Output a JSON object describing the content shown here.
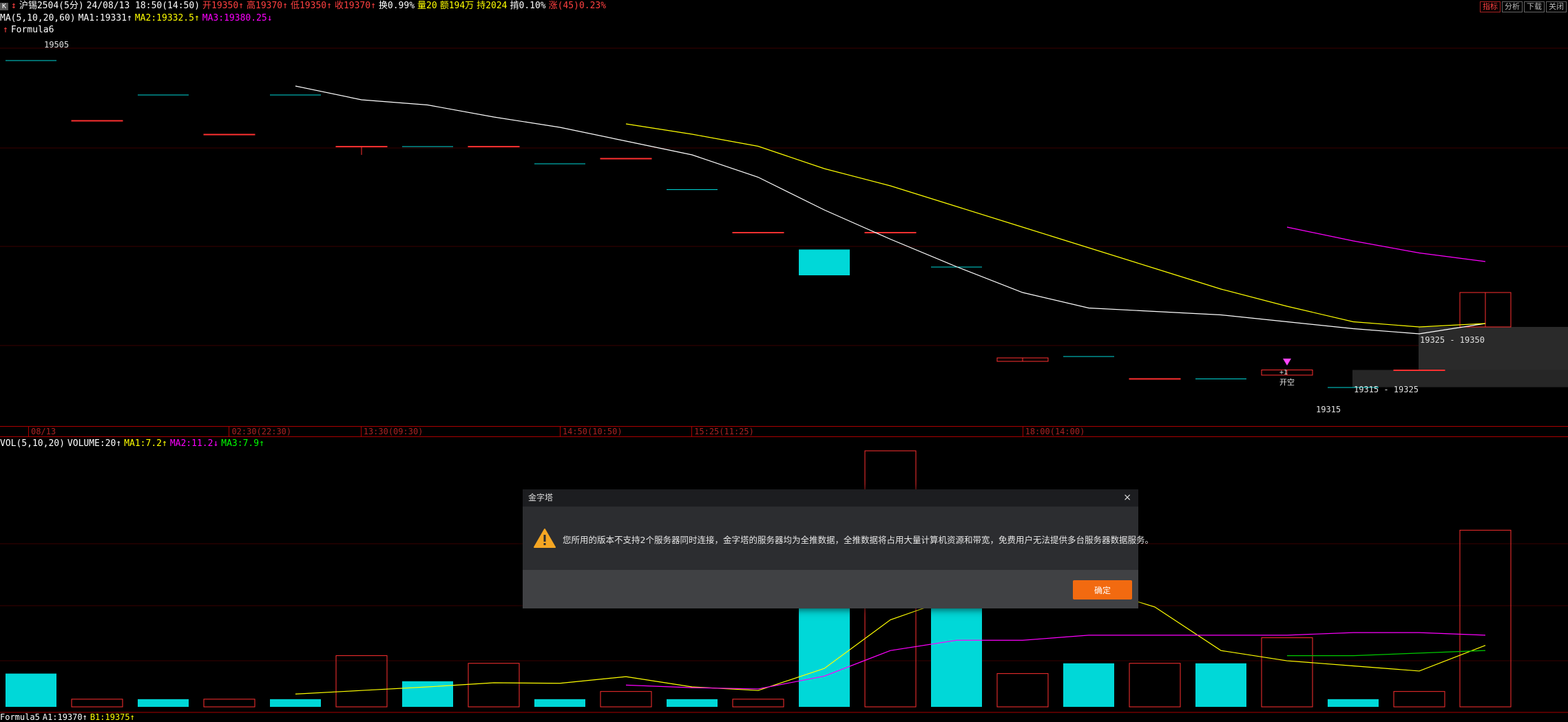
{
  "header": {
    "icon_label": "K",
    "marker": "↕",
    "symbol": "沪锡2504(5分)",
    "datetime": "24/08/13 18:50(14:50)",
    "open": "开19350↑",
    "high": "高19370↑",
    "low": "低19350↑",
    "close": "收19370↑",
    "change_pct": "换0.99%",
    "volume": "量20",
    "amount": "额194万",
    "holding": "持2024",
    "amplitude": "掯0.10%",
    "rise": "涨(45)0.23%"
  },
  "ma_line": {
    "label": "MA(5,10,20,60)",
    "ma1": "MA1:19331↑",
    "ma2": "MA2:19332.5↑",
    "ma3": "MA3:19380.25↓"
  },
  "formula6": {
    "arrow": "↑",
    "label": "Formula6"
  },
  "top_buttons": [
    "指标",
    "分析",
    "下载",
    "关闭"
  ],
  "price_labels": {
    "high_price": "19505",
    "zone_upper": "19325 - 19350",
    "zone_lower": "19315 - 19325",
    "low_price": "19315",
    "signal_top": "+1",
    "signal_text": "开空"
  },
  "time_axis": [
    {
      "label": "08/13",
      "pos": 0.018
    },
    {
      "label": "02:30(22:30)",
      "pos": 0.146
    },
    {
      "label": "13:30(09:30)",
      "pos": 0.23
    },
    {
      "label": "14:50(10:50)",
      "pos": 0.357
    },
    {
      "label": "15:25(11:25)",
      "pos": 0.441
    },
    {
      "label": "18:00(14:00)",
      "pos": 0.652
    }
  ],
  "vol_line": {
    "label": "VOL(5,10,20)",
    "volume": "VOLUME:20↑",
    "ma1": "MA1:7.2↑",
    "ma2": "MA2:11.2↓",
    "ma3": "MA3:7.9↑"
  },
  "formula5": {
    "label": "Formula5",
    "a1": "A1:19370↑",
    "b1": "B1:19375↑"
  },
  "dialog": {
    "title": "金字塔",
    "close": "×",
    "message": "您所用的版本不支持2个服务器同时连接，金字塔的服务器均为全推数据，全推数据将占用大量计算机资源和带宽，免费用户无法提供多台服务器数据服务。",
    "ok_label": "确定",
    "icon": "warning-icon"
  },
  "colors": {
    "up": "#ff3030",
    "down": "#00d8d8",
    "ma1": "#ffffff",
    "ma2": "#ffff00",
    "ma3": "#ff00ff",
    "vol_ma3": "#00cc00",
    "button": "#f26a10"
  },
  "chart_data": {
    "type": "candlestick",
    "candles": [
      {
        "o": 19505,
        "c": 19505,
        "h": 19505,
        "l": 19505
      },
      {
        "o": 19470,
        "c": 19470,
        "h": 19470,
        "l": 19470
      },
      {
        "o": 19485,
        "c": 19485,
        "h": 19485,
        "l": 19485
      },
      {
        "o": 19462,
        "c": 19462,
        "h": 19462,
        "l": 19462
      },
      {
        "o": 19485,
        "c": 19485,
        "h": 19485,
        "l": 19485
      },
      {
        "o": 19455,
        "c": 19455,
        "h": 19455,
        "l": 19450
      },
      {
        "o": 19455,
        "c": 19455,
        "h": 19455,
        "l": 19455
      },
      {
        "o": 19455,
        "c": 19455,
        "h": 19455,
        "l": 19455
      },
      {
        "o": 19445,
        "c": 19445,
        "h": 19445,
        "l": 19445
      },
      {
        "o": 19448,
        "c": 19448,
        "h": 19448,
        "l": 19448
      },
      {
        "o": 19430,
        "c": 19430,
        "h": 19430,
        "l": 19430
      },
      {
        "o": 19405,
        "c": 19405,
        "h": 19405,
        "l": 19405
      },
      {
        "o": 19395,
        "c": 19380,
        "h": 19395,
        "l": 19380
      },
      {
        "o": 19405,
        "c": 19405,
        "h": 19405,
        "l": 19405
      },
      {
        "o": 19385,
        "c": 19385,
        "h": 19385,
        "l": 19385
      },
      {
        "o": 19330,
        "c": 19332,
        "h": 19332,
        "l": 19330
      },
      {
        "o": 19333,
        "c": 19333,
        "h": 19333,
        "l": 19333
      },
      {
        "o": 19320,
        "c": 19320,
        "h": 19320,
        "l": 19320
      },
      {
        "o": 19320,
        "c": 19320,
        "h": 19320,
        "l": 19320
      },
      {
        "o": 19322,
        "c": 19325,
        "h": 19325,
        "l": 19322
      },
      {
        "o": 19315,
        "c": 19315,
        "h": 19315,
        "l": 19315
      },
      {
        "o": 19325,
        "c": 19325,
        "h": 19325,
        "l": 19325
      },
      {
        "o": 19350,
        "c": 19370,
        "h": 19370,
        "l": 19350
      }
    ],
    "ma1": [
      null,
      null,
      null,
      null,
      19490,
      19482,
      19479,
      19472,
      19466,
      19458,
      19450,
      19437,
      19418,
      19401,
      19385,
      19370,
      19361,
      19359,
      19357,
      19353,
      19349,
      19346,
      19352
    ],
    "ma2": [
      null,
      null,
      null,
      null,
      null,
      null,
      null,
      null,
      null,
      19468,
      19462,
      19455,
      19442,
      19432,
      19420,
      19408,
      19396,
      19384,
      19372,
      19362,
      19353,
      19350,
      19352
    ],
    "ma3": [
      null,
      null,
      null,
      null,
      null,
      null,
      null,
      null,
      null,
      null,
      null,
      null,
      null,
      null,
      null,
      null,
      null,
      null,
      null,
      19408,
      19400,
      19393,
      19388
    ],
    "volume": [
      13,
      3,
      3,
      3,
      3,
      20,
      10,
      17,
      3,
      6,
      3,
      3,
      60,
      100,
      48,
      13,
      17,
      17,
      17,
      27,
      3,
      6,
      69
    ],
    "vol_ma1": [
      null,
      null,
      null,
      null,
      5,
      6.4,
      7.8,
      9.4,
      9.2,
      11.8,
      7.8,
      6.4,
      15,
      34,
      43,
      45,
      47,
      39,
      22,
      18,
      16,
      14,
      24
    ],
    "vol_ma2": [
      null,
      null,
      null,
      null,
      null,
      null,
      null,
      null,
      null,
      8.5,
      7.5,
      7,
      12,
      22,
      26,
      26,
      28,
      28,
      28,
      28,
      29,
      29,
      28
    ],
    "vol_ma3": [
      null,
      null,
      null,
      null,
      null,
      null,
      null,
      null,
      null,
      null,
      null,
      null,
      null,
      null,
      null,
      null,
      null,
      null,
      null,
      20,
      20,
      21,
      22
    ]
  }
}
